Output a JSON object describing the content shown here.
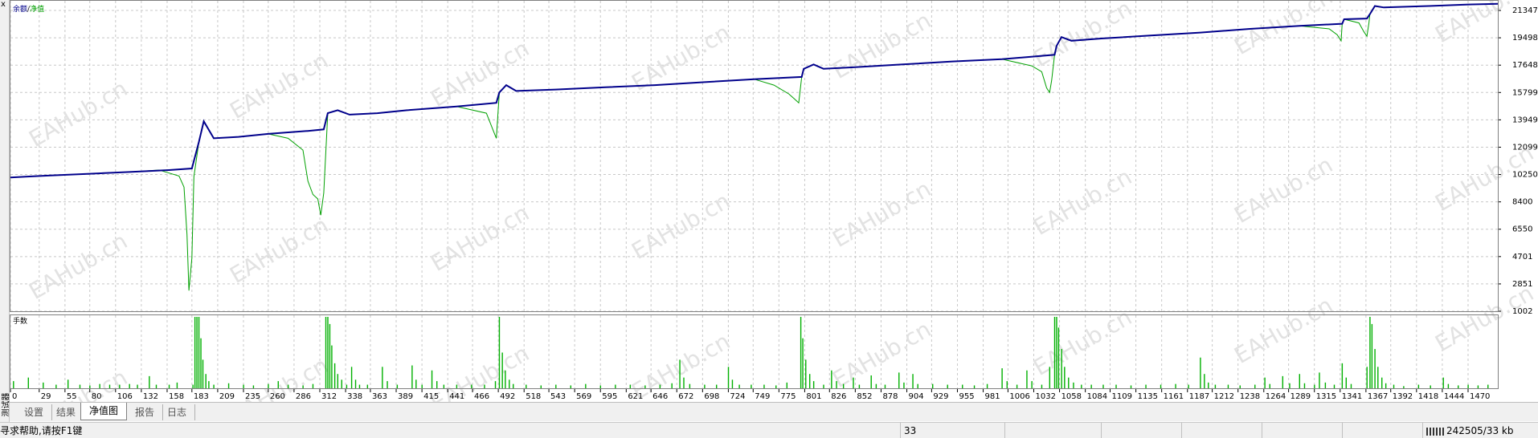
{
  "window": {
    "close_glyph": "x",
    "side_label": "测试器"
  },
  "legend": {
    "balance": "余额",
    "separator": "/",
    "equity": "净值",
    "balance_color": "#00008b",
    "equity_color": "#00a000"
  },
  "volume_label": "手数",
  "watermark": "EAHub.cn",
  "chart_data": {
    "type": "line",
    "series": [
      {
        "name": "余额",
        "color": "#00008b",
        "points": [
          [
            0,
            10050
          ],
          [
            15,
            10100
          ],
          [
            40,
            10180
          ],
          [
            80,
            10300
          ],
          [
            120,
            10420
          ],
          [
            160,
            10550
          ],
          [
            183,
            10660
          ],
          [
            190,
            12450
          ],
          [
            195,
            13850
          ],
          [
            205,
            12700
          ],
          [
            230,
            12800
          ],
          [
            260,
            13000
          ],
          [
            300,
            13200
          ],
          [
            316,
            13300
          ],
          [
            320,
            14400
          ],
          [
            330,
            14600
          ],
          [
            342,
            14300
          ],
          [
            370,
            14400
          ],
          [
            400,
            14600
          ],
          [
            450,
            14850
          ],
          [
            490,
            15100
          ],
          [
            493,
            15800
          ],
          [
            500,
            16300
          ],
          [
            510,
            15900
          ],
          [
            550,
            16000
          ],
          [
            600,
            16150
          ],
          [
            650,
            16300
          ],
          [
            700,
            16500
          ],
          [
            750,
            16700
          ],
          [
            798,
            16850
          ],
          [
            800,
            17400
          ],
          [
            810,
            17700
          ],
          [
            820,
            17400
          ],
          [
            850,
            17500
          ],
          [
            900,
            17700
          ],
          [
            950,
            17900
          ],
          [
            1000,
            18050
          ],
          [
            1053,
            18350
          ],
          [
            1055,
            18950
          ],
          [
            1060,
            19550
          ],
          [
            1070,
            19300
          ],
          [
            1100,
            19450
          ],
          [
            1150,
            19650
          ],
          [
            1200,
            19850
          ],
          [
            1250,
            20100
          ],
          [
            1300,
            20300
          ],
          [
            1343,
            20450
          ],
          [
            1345,
            20750
          ],
          [
            1368,
            20800
          ],
          [
            1371,
            21100
          ],
          [
            1376,
            21650
          ],
          [
            1385,
            21550
          ],
          [
            1430,
            21650
          ],
          [
            1470,
            21750
          ],
          [
            1500,
            21800
          ]
        ]
      },
      {
        "name": "净值",
        "color": "#00a000",
        "points": [
          [
            0,
            10050
          ],
          [
            15,
            10100
          ],
          [
            40,
            10180
          ],
          [
            80,
            10300
          ],
          [
            120,
            10420
          ],
          [
            150,
            10550
          ],
          [
            160,
            10350
          ],
          [
            170,
            10150
          ],
          [
            175,
            9400
          ],
          [
            178,
            6200
          ],
          [
            180,
            2400
          ],
          [
            183,
            4600
          ],
          [
            185,
            10100
          ],
          [
            190,
            12450
          ],
          [
            195,
            13850
          ],
          [
            205,
            12700
          ],
          [
            230,
            12800
          ],
          [
            260,
            13000
          ],
          [
            280,
            12700
          ],
          [
            295,
            11900
          ],
          [
            300,
            9800
          ],
          [
            305,
            8900
          ],
          [
            310,
            8600
          ],
          [
            313,
            7500
          ],
          [
            316,
            9000
          ],
          [
            320,
            14400
          ],
          [
            330,
            14600
          ],
          [
            342,
            14300
          ],
          [
            370,
            14400
          ],
          [
            400,
            14600
          ],
          [
            450,
            14850
          ],
          [
            480,
            14400
          ],
          [
            487,
            13200
          ],
          [
            490,
            12700
          ],
          [
            493,
            15800
          ],
          [
            500,
            16300
          ],
          [
            510,
            15900
          ],
          [
            550,
            16000
          ],
          [
            600,
            16150
          ],
          [
            650,
            16300
          ],
          [
            700,
            16500
          ],
          [
            750,
            16700
          ],
          [
            770,
            16300
          ],
          [
            785,
            15700
          ],
          [
            790,
            15400
          ],
          [
            795,
            15100
          ],
          [
            798,
            16850
          ],
          [
            800,
            17400
          ],
          [
            810,
            17700
          ],
          [
            820,
            17400
          ],
          [
            850,
            17500
          ],
          [
            900,
            17700
          ],
          [
            950,
            17900
          ],
          [
            1000,
            18050
          ],
          [
            1030,
            17600
          ],
          [
            1040,
            17200
          ],
          [
            1045,
            16100
          ],
          [
            1048,
            15800
          ],
          [
            1050,
            16600
          ],
          [
            1053,
            18350
          ],
          [
            1055,
            18950
          ],
          [
            1060,
            19550
          ],
          [
            1070,
            19300
          ],
          [
            1100,
            19450
          ],
          [
            1150,
            19650
          ],
          [
            1200,
            19850
          ],
          [
            1250,
            20100
          ],
          [
            1300,
            20300
          ],
          [
            1330,
            20100
          ],
          [
            1338,
            19700
          ],
          [
            1342,
            19300
          ],
          [
            1343,
            20450
          ],
          [
            1345,
            20750
          ],
          [
            1360,
            20500
          ],
          [
            1365,
            19900
          ],
          [
            1368,
            19600
          ],
          [
            1370,
            20500
          ],
          [
            1371,
            21100
          ],
          [
            1376,
            21650
          ],
          [
            1385,
            21550
          ],
          [
            1430,
            21650
          ],
          [
            1470,
            21750
          ],
          [
            1500,
            21800
          ]
        ]
      }
    ],
    "volume": {
      "series_name": "手数",
      "color": "#00b000",
      "spikes": [
        [
          3,
          0.1
        ],
        [
          18,
          0.15
        ],
        [
          33,
          0.08
        ],
        [
          46,
          0.05
        ],
        [
          58,
          0.12
        ],
        [
          70,
          0.05
        ],
        [
          80,
          0.04
        ],
        [
          90,
          0.06
        ],
        [
          100,
          0.05
        ],
        [
          110,
          0.05
        ],
        [
          120,
          0.06
        ],
        [
          128,
          0.05
        ],
        [
          140,
          0.17
        ],
        [
          147,
          0.05
        ],
        [
          160,
          0.05
        ],
        [
          168,
          0.08
        ],
        [
          184,
          0.05
        ],
        [
          186,
          1.0
        ],
        [
          188,
          1.0
        ],
        [
          190,
          1.0
        ],
        [
          192,
          0.7
        ],
        [
          194,
          0.4
        ],
        [
          197,
          0.2
        ],
        [
          200,
          0.1
        ],
        [
          205,
          0.05
        ],
        [
          220,
          0.07
        ],
        [
          235,
          0.05
        ],
        [
          245,
          0.04
        ],
        [
          260,
          0.06
        ],
        [
          270,
          0.1
        ],
        [
          280,
          0.05
        ],
        [
          295,
          0.04
        ],
        [
          305,
          0.06
        ],
        [
          318,
          1.0
        ],
        [
          320,
          1.0
        ],
        [
          322,
          0.9
        ],
        [
          324,
          0.6
        ],
        [
          327,
          0.35
        ],
        [
          330,
          0.2
        ],
        [
          334,
          0.12
        ],
        [
          339,
          0.05
        ],
        [
          344,
          0.3
        ],
        [
          348,
          0.12
        ],
        [
          352,
          0.05
        ],
        [
          360,
          0.05
        ],
        [
          375,
          0.3
        ],
        [
          380,
          0.1
        ],
        [
          390,
          0.05
        ],
        [
          405,
          0.32
        ],
        [
          409,
          0.12
        ],
        [
          415,
          0.05
        ],
        [
          425,
          0.25
        ],
        [
          430,
          0.1
        ],
        [
          437,
          0.05
        ],
        [
          450,
          0.05
        ],
        [
          465,
          0.05
        ],
        [
          478,
          0.05
        ],
        [
          489,
          0.1
        ],
        [
          493,
          1.0
        ],
        [
          496,
          0.5
        ],
        [
          499,
          0.25
        ],
        [
          503,
          0.12
        ],
        [
          507,
          0.06
        ],
        [
          520,
          0.05
        ],
        [
          535,
          0.04
        ],
        [
          550,
          0.05
        ],
        [
          565,
          0.04
        ],
        [
          580,
          0.06
        ],
        [
          595,
          0.04
        ],
        [
          610,
          0.05
        ],
        [
          625,
          0.05
        ],
        [
          640,
          0.04
        ],
        [
          655,
          0.05
        ],
        [
          667,
          0.07
        ],
        [
          675,
          0.4
        ],
        [
          679,
          0.15
        ],
        [
          685,
          0.06
        ],
        [
          700,
          0.05
        ],
        [
          712,
          0.05
        ],
        [
          724,
          0.3
        ],
        [
          728,
          0.12
        ],
        [
          735,
          0.05
        ],
        [
          747,
          0.05
        ],
        [
          760,
          0.05
        ],
        [
          772,
          0.04
        ],
        [
          783,
          0.08
        ],
        [
          797,
          1.0
        ],
        [
          799,
          0.7
        ],
        [
          802,
          0.4
        ],
        [
          806,
          0.2
        ],
        [
          810,
          0.1
        ],
        [
          820,
          0.05
        ],
        [
          828,
          0.25
        ],
        [
          833,
          0.1
        ],
        [
          840,
          0.06
        ],
        [
          850,
          0.15
        ],
        [
          856,
          0.05
        ],
        [
          868,
          0.18
        ],
        [
          873,
          0.06
        ],
        [
          882,
          0.05
        ],
        [
          896,
          0.22
        ],
        [
          901,
          0.08
        ],
        [
          910,
          0.2
        ],
        [
          915,
          0.06
        ],
        [
          930,
          0.06
        ],
        [
          945,
          0.05
        ],
        [
          960,
          0.05
        ],
        [
          972,
          0.04
        ],
        [
          985,
          0.06
        ],
        [
          1000,
          0.28
        ],
        [
          1005,
          0.1
        ],
        [
          1015,
          0.05
        ],
        [
          1025,
          0.25
        ],
        [
          1030,
          0.1
        ],
        [
          1040,
          0.05
        ],
        [
          1048,
          0.3
        ],
        [
          1053,
          1.0
        ],
        [
          1055,
          1.0
        ],
        [
          1057,
          0.85
        ],
        [
          1060,
          0.55
        ],
        [
          1063,
          0.3
        ],
        [
          1067,
          0.15
        ],
        [
          1072,
          0.08
        ],
        [
          1080,
          0.05
        ],
        [
          1090,
          0.05
        ],
        [
          1102,
          0.05
        ],
        [
          1115,
          0.05
        ],
        [
          1130,
          0.04
        ],
        [
          1145,
          0.05
        ],
        [
          1160,
          0.05
        ],
        [
          1175,
          0.06
        ],
        [
          1188,
          0.05
        ],
        [
          1200,
          0.43
        ],
        [
          1204,
          0.2
        ],
        [
          1208,
          0.08
        ],
        [
          1215,
          0.05
        ],
        [
          1228,
          0.05
        ],
        [
          1240,
          0.04
        ],
        [
          1255,
          0.05
        ],
        [
          1265,
          0.15
        ],
        [
          1270,
          0.06
        ],
        [
          1283,
          0.17
        ],
        [
          1290,
          0.07
        ],
        [
          1300,
          0.2
        ],
        [
          1305,
          0.07
        ],
        [
          1315,
          0.05
        ],
        [
          1320,
          0.22
        ],
        [
          1326,
          0.08
        ],
        [
          1335,
          0.05
        ],
        [
          1343,
          0.35
        ],
        [
          1347,
          0.15
        ],
        [
          1352,
          0.06
        ],
        [
          1368,
          0.3
        ],
        [
          1371,
          1.0
        ],
        [
          1373,
          0.9
        ],
        [
          1376,
          0.55
        ],
        [
          1379,
          0.3
        ],
        [
          1383,
          0.15
        ],
        [
          1387,
          0.07
        ],
        [
          1395,
          0.05
        ],
        [
          1405,
          0.03
        ],
        [
          1420,
          0.05
        ],
        [
          1432,
          0.04
        ],
        [
          1445,
          0.15
        ],
        [
          1450,
          0.06
        ],
        [
          1460,
          0.04
        ],
        [
          1470,
          0.05
        ],
        [
          1480,
          0.04
        ],
        [
          1490,
          0.05
        ]
      ]
    },
    "x_ticks": [
      0,
      29,
      55,
      80,
      106,
      132,
      158,
      183,
      209,
      235,
      260,
      286,
      312,
      338,
      363,
      389,
      415,
      441,
      466,
      492,
      518,
      543,
      569,
      595,
      621,
      646,
      672,
      698,
      724,
      749,
      775,
      801,
      826,
      852,
      878,
      904,
      929,
      955,
      981,
      1006,
      1032,
      1058,
      1084,
      1109,
      1135,
      1161,
      1187,
      1212,
      1238,
      1264,
      1289,
      1315,
      1341,
      1367,
      1392,
      1418,
      1444,
      1470
    ],
    "y_ticks": [
      1002,
      2851,
      4701,
      6550,
      8400,
      10250,
      12099,
      13949,
      15799,
      17648,
      19498,
      21347
    ],
    "xlim": [
      0,
      1500
    ],
    "ylim": [
      1002,
      22000
    ],
    "grid": true
  },
  "tabs": [
    {
      "label": "设置",
      "active": false
    },
    {
      "label": "结果",
      "active": false
    },
    {
      "label": "净值图",
      "active": true
    },
    {
      "label": "报告",
      "active": false
    },
    {
      "label": "日志",
      "active": false
    }
  ],
  "status": {
    "help": "寻求帮助,请按F1键",
    "count": "33",
    "traffic": "242505/33 kb"
  }
}
